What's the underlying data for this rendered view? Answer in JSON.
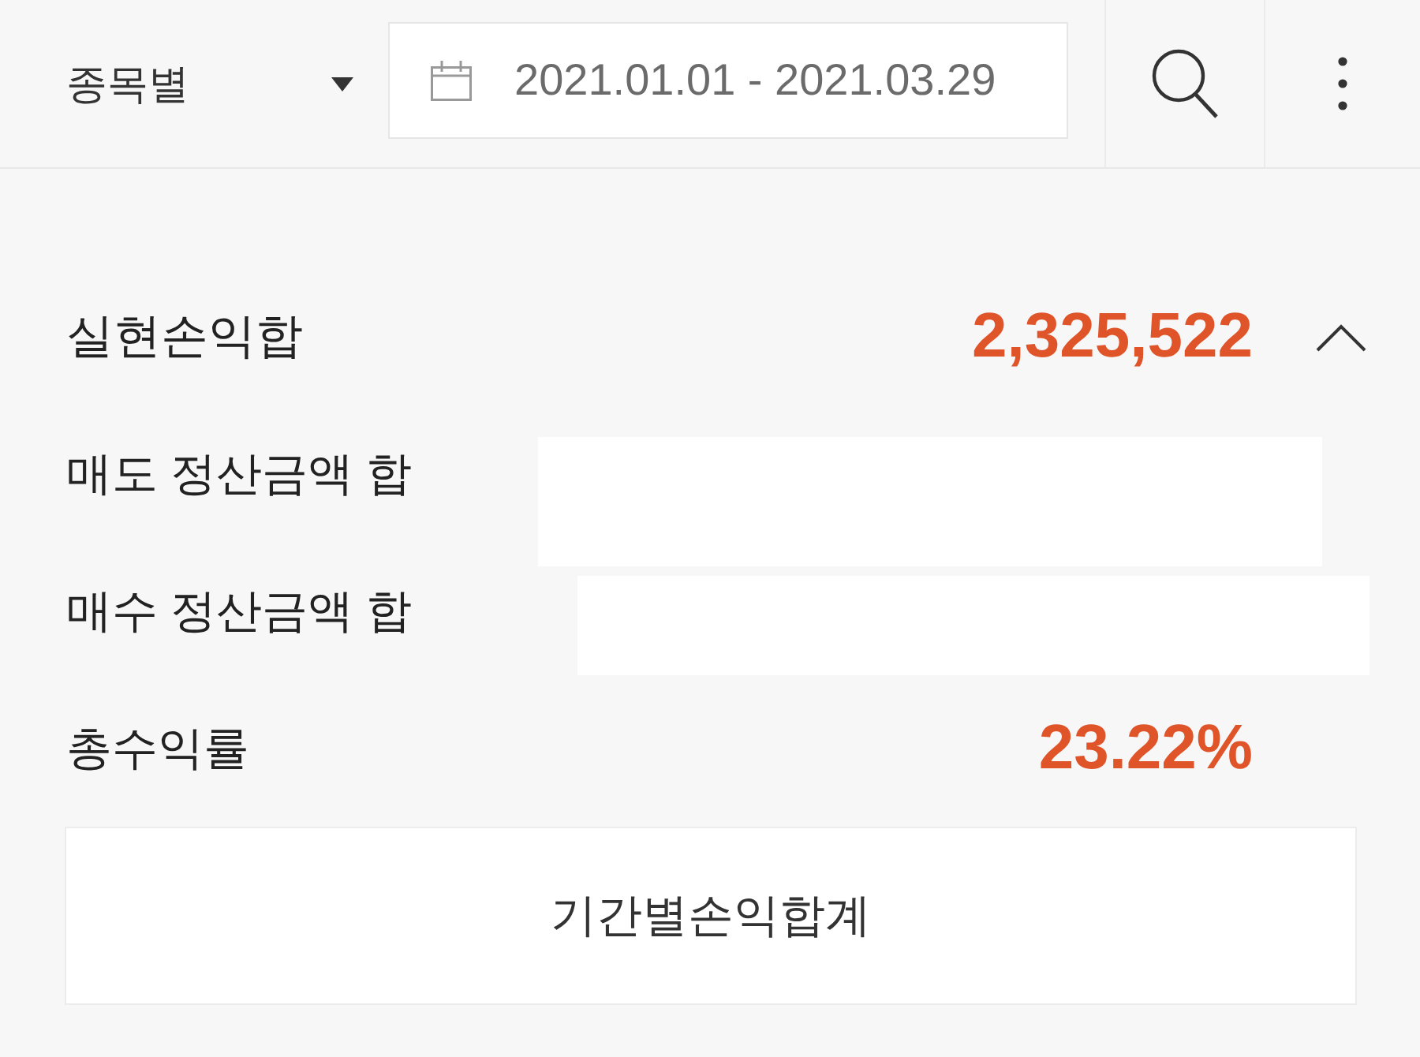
{
  "toolbar": {
    "filter": {
      "value": "종목별"
    },
    "date_range": {
      "value": "2021.01.01 - 2021.03.29"
    }
  },
  "summary": {
    "title": "실현손익합",
    "value": "2,325,522",
    "expanded": true,
    "rows": [
      {
        "kind": "redacted",
        "label": "매도 정산금액 합"
      },
      {
        "kind": "redacted",
        "label": "매수 정산금액 합"
      },
      {
        "kind": "value",
        "label": "총수익률",
        "value": "23.22%"
      }
    ]
  },
  "button": {
    "label": "기간별손익합계"
  }
}
